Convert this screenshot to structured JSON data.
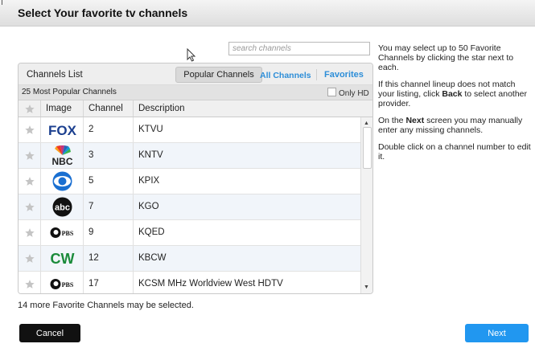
{
  "title": "Select Your favorite tv channels",
  "search": {
    "placeholder": "search channels"
  },
  "panel": {
    "title": "Channels List",
    "tabs": {
      "popular": "Popular Channels",
      "all": "All Channels",
      "favorites": "Favorites"
    },
    "subtitle": "25 Most Popular Channels",
    "only_hd": "Only HD",
    "columns": {
      "image": "Image",
      "channel": "Channel",
      "description": "Description"
    }
  },
  "rows": [
    {
      "logo": "FOX",
      "logo_name": "fox-logo",
      "channel": "2",
      "description": "KTVU"
    },
    {
      "logo": "NBC",
      "logo_name": "nbc-logo",
      "channel": "3",
      "description": "KNTV"
    },
    {
      "logo": "CBS",
      "logo_name": "cbs-eye-logo",
      "channel": "5",
      "description": "KPIX"
    },
    {
      "logo": "abc",
      "logo_name": "abc-logo",
      "channel": "7",
      "description": "KGO"
    },
    {
      "logo": "PBS",
      "logo_name": "pbs-logo",
      "channel": "9",
      "description": "KQED"
    },
    {
      "logo": "CW",
      "logo_name": "cw-logo",
      "channel": "12",
      "description": "KBCW"
    },
    {
      "logo": "PBS",
      "logo_name": "pbs-logo",
      "channel": "17",
      "description": "KCSM MHz Worldview West HDTV"
    }
  ],
  "remaining": "14 more Favorite Channels may be selected.",
  "buttons": {
    "cancel": "Cancel",
    "next": "Next"
  },
  "help": {
    "p1": "You may select up to 50 Favorite Channels by clicking the star next to each.",
    "p2_a": "If this channel lineup does not match your listing, click ",
    "p2_b": "Back",
    "p2_c": " to select another provider.",
    "p3_a": "On the ",
    "p3_b": "Next",
    "p3_c": " screen you may manually enter any missing channels.",
    "p4": "Double click on a channel number to edit it."
  },
  "colors": {
    "accent": "#2197f0",
    "link": "#2d8ed8",
    "cancel": "#111111"
  }
}
